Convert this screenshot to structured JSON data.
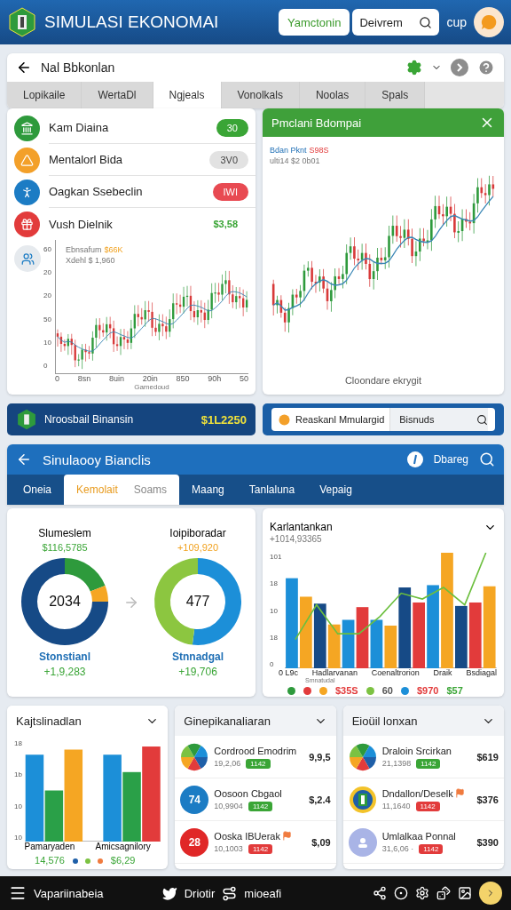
{
  "header": {
    "title": "SIMULASI EKONOMAI",
    "action": "Yamctonin",
    "search": {
      "value": "Deivrem"
    },
    "user_label": "cup"
  },
  "panel": {
    "title": "Nal Bbkonlan",
    "tabs": [
      {
        "label": "Lopikaile",
        "selected": false
      },
      {
        "label": "WertaDl",
        "selected": false
      },
      {
        "label": "Ngjeals",
        "selected": true
      },
      {
        "label": "Vonolkals",
        "selected": false
      },
      {
        "label": "Noolas",
        "selected": false
      },
      {
        "label": "Spals",
        "selected": false
      }
    ],
    "items": [
      {
        "name": "Kam Diaina",
        "color": "#2e9a3c",
        "badge": "30",
        "kind": "success"
      },
      {
        "name": "Mentalorl Bida",
        "color": "#f3a02a",
        "badge": "3V0",
        "kind": "neutral"
      },
      {
        "name": "Oagkan Ssebeclin",
        "color": "#1c7cc4",
        "badge": "IWI",
        "kind": "danger"
      },
      {
        "name": "Vush Dielnik",
        "color": "#e23b3b",
        "badge": "$3,58",
        "kind": "amount"
      }
    ],
    "chart": {
      "legend_label": "Ebnsafum",
      "legend_value": "$66K",
      "legend_sub": "Xdehl $ 1,960",
      "y_ticks": [
        "60",
        "20",
        "20",
        "50",
        "10",
        "0"
      ],
      "x_ticks": [
        "0",
        "8sn",
        "8uin",
        "20in",
        "850",
        "90h",
        "50"
      ],
      "x_label": "Gamedoud"
    }
  },
  "detail": {
    "title": "Pmclani Bdompai",
    "label": "Bdan Pknt",
    "value": "S98S",
    "sub": "ulti14 $2 0b01",
    "caption": "Cloondare ekrygit"
  },
  "balance": {
    "label": "Nroosbail Binansin",
    "value": "$1L2250"
  },
  "finder": {
    "value": "Reaskanl Mmulargid",
    "scope": "Bisnuds"
  },
  "simulation": {
    "title": "Sinulaooy Bianclis",
    "action": "Dbareg",
    "tabs": [
      {
        "label": "Oneia",
        "selected": false
      },
      {
        "label": "Kemolait",
        "sub": "Soams",
        "selected": true
      },
      {
        "label": "Maang",
        "selected": false
      },
      {
        "label": "Tanlaluna",
        "selected": false
      },
      {
        "label": "Vepaig",
        "selected": false
      }
    ],
    "donuts": [
      {
        "title": "Slumeslem",
        "value": "$116,5785",
        "color": "#3aa536",
        "center": "2034",
        "label": "Stonstianl",
        "amount": "+1,9,283"
      },
      {
        "title": "Ioipiboradar",
        "value": "+109,920",
        "color": "#f1a11e",
        "center": "477",
        "label": "Stnnadgal",
        "amount": "+19,706"
      }
    ],
    "bars": {
      "title": "Karlantankan",
      "value": "+1014,93365",
      "y_ticks": [
        "101",
        "18",
        "10",
        "18",
        "0"
      ],
      "x_labels": [
        "0 L9c",
        "Hadlarvanan",
        "Coenaltrorion",
        "Draik",
        "Bsdiagal"
      ],
      "sub_label": "Smnatudal",
      "legend": [
        {
          "kind": "dot",
          "color": "#2e9a3c"
        },
        {
          "kind": "dot",
          "color": "#e23b3b"
        },
        {
          "kind": "dot",
          "color": "#f5a623"
        },
        {
          "kind": "value",
          "text": "$35S",
          "color": "#e23b3b"
        },
        {
          "kind": "dot",
          "color": "#7cc242"
        },
        {
          "kind": "value",
          "text": "60",
          "color": "#555555"
        },
        {
          "kind": "dot",
          "color": "#1c8fd8"
        },
        {
          "kind": "value",
          "text": "$970",
          "color": "#e23b3b"
        },
        {
          "kind": "value",
          "text": "$57",
          "color": "#3aa536"
        }
      ]
    }
  },
  "cards": [
    {
      "title": "Kajtslinadlan",
      "kind": "chart",
      "y_ticks": [
        "18",
        "1b",
        "10",
        "10"
      ],
      "groups": [
        {
          "label": "Pamaryaden",
          "value": "14,576"
        },
        {
          "label": "Amicsagnilory",
          "value": "$6,29"
        }
      ]
    },
    {
      "title": "Ginepikanaliaran",
      "kind": "list",
      "rows": [
        {
          "kind": "pie",
          "name": "Cordrood Emodrim",
          "sub": "19,2,06",
          "badge": {
            "text": "1142",
            "color": "#3aa536"
          },
          "value": "9,9,5",
          "tagged": false
        },
        {
          "kind": "number",
          "icon_text": "74",
          "color": "#1c7cc4",
          "name": "Oosoon Cbgaol",
          "sub": "10,9904",
          "badge": {
            "text": "1142",
            "color": "#3aa536"
          },
          "value": "$,2.4",
          "tagged": false
        },
        {
          "kind": "number",
          "icon_text": "28",
          "color": "#e02727",
          "name": "Ooska IBUerak",
          "sub": "10,1003",
          "badge": {
            "text": "1142",
            "color": "#e23b3b"
          },
          "value": "$,09",
          "tagged": true
        }
      ]
    },
    {
      "title": "Eioüil lonxan",
      "kind": "list",
      "rows": [
        {
          "kind": "pie",
          "name": "Draloin Srcirkan",
          "sub": "21,1398",
          "badge": {
            "text": "1142",
            "color": "#3aa536"
          },
          "value": "$619",
          "tagged": false
        },
        {
          "kind": "logo",
          "name": "Dndallon/Deselk",
          "sub": "11,1640",
          "badge": {
            "text": "1142",
            "color": "#e23b3b"
          },
          "value": "$376",
          "tagged": true
        },
        {
          "kind": "avatar",
          "color": "#a9b4e6",
          "name": "Umlalkaa Ponnal",
          "sub": "31,6,06 ·",
          "badge": {
            "text": "1142",
            "color": "#e23b3b"
          },
          "value": "$390",
          "tagged": false
        }
      ]
    }
  ],
  "footer": {
    "title": "Vapariinabeia",
    "links": [
      "Driotir",
      "mioeafi"
    ]
  }
}
